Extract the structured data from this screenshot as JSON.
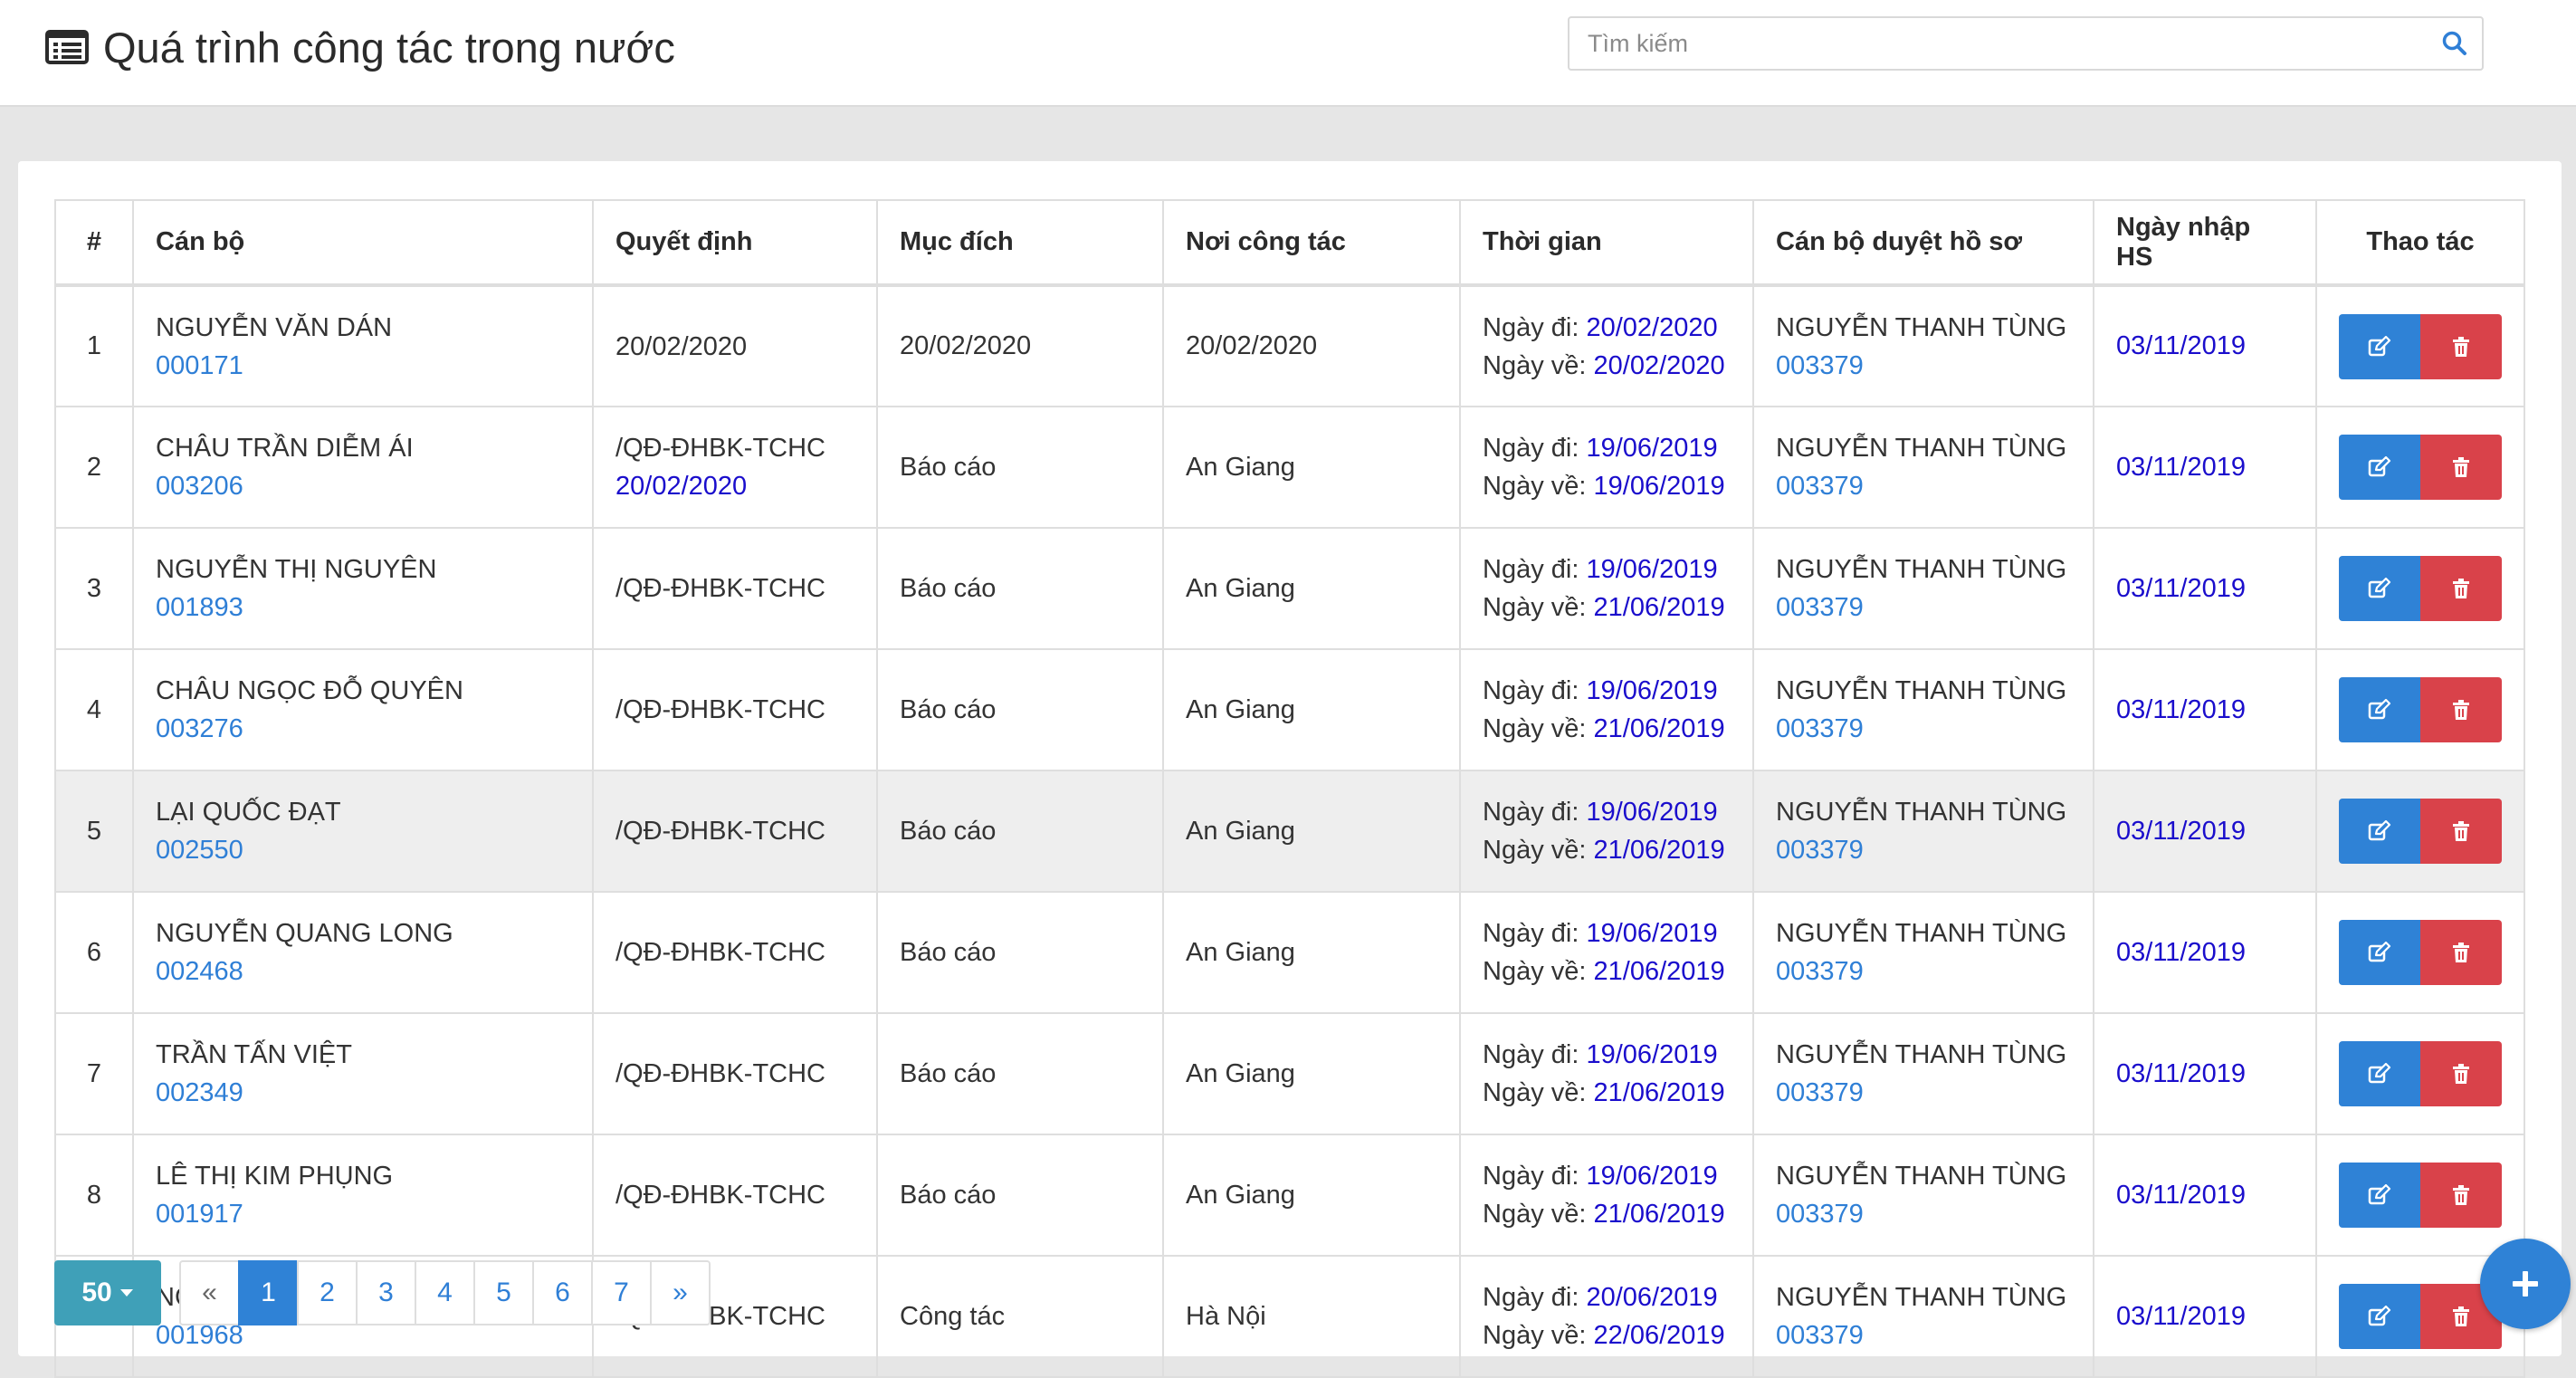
{
  "header": {
    "title": "Quá trình công tác trong nước",
    "search_placeholder": "Tìm kiếm"
  },
  "table": {
    "columns": [
      "#",
      "Cán bộ",
      "Quyết định",
      "Mục đích",
      "Nơi công tác",
      "Thời gian",
      "Cán bộ duyệt hồ sơ",
      "Ngày nhập HS",
      "Thao tác"
    ],
    "go_label": "Ngày đi:",
    "return_label": "Ngày về:",
    "rows": [
      {
        "index": "1",
        "staff_name": "NGUYỄN VĂN DÁN",
        "staff_id": "000171",
        "decision": "20/02/2020",
        "decision_date": "",
        "purpose": "20/02/2020",
        "location": "20/02/2020",
        "date_go": "20/02/2020",
        "date_return": "20/02/2020",
        "approver_name": "NGUYỄN THANH TÙNG",
        "approver_id": "003379",
        "entry_date": "03/11/2019"
      },
      {
        "index": "2",
        "staff_name": "CHÂU TRẦN DIỄM ÁI",
        "staff_id": "003206",
        "decision": "/QĐ-ĐHBK-TCHC",
        "decision_date": "20/02/2020",
        "purpose": "Báo cáo",
        "location": "An Giang",
        "date_go": "19/06/2019",
        "date_return": "19/06/2019",
        "approver_name": "NGUYỄN THANH TÙNG",
        "approver_id": "003379",
        "entry_date": "03/11/2019"
      },
      {
        "index": "3",
        "staff_name": "NGUYỄN THỊ NGUYÊN",
        "staff_id": "001893",
        "decision": "/QĐ-ĐHBK-TCHC",
        "decision_date": "",
        "purpose": "Báo cáo",
        "location": "An Giang",
        "date_go": "19/06/2019",
        "date_return": "21/06/2019",
        "approver_name": "NGUYỄN THANH TÙNG",
        "approver_id": "003379",
        "entry_date": "03/11/2019"
      },
      {
        "index": "4",
        "staff_name": "CHÂU NGỌC ĐỖ QUYÊN",
        "staff_id": "003276",
        "decision": "/QĐ-ĐHBK-TCHC",
        "decision_date": "",
        "purpose": "Báo cáo",
        "location": "An Giang",
        "date_go": "19/06/2019",
        "date_return": "21/06/2019",
        "approver_name": "NGUYỄN THANH TÙNG",
        "approver_id": "003379",
        "entry_date": "03/11/2019"
      },
      {
        "index": "5",
        "staff_name": "LẠI QUỐC ĐẠT",
        "staff_id": "002550",
        "decision": "/QĐ-ĐHBK-TCHC",
        "decision_date": "",
        "purpose": "Báo cáo",
        "location": "An Giang",
        "date_go": "19/06/2019",
        "date_return": "21/06/2019",
        "approver_name": "NGUYỄN THANH TÙNG",
        "approver_id": "003379",
        "entry_date": "03/11/2019"
      },
      {
        "index": "6",
        "staff_name": "NGUYỄN QUANG LONG",
        "staff_id": "002468",
        "decision": "/QĐ-ĐHBK-TCHC",
        "decision_date": "",
        "purpose": "Báo cáo",
        "location": "An Giang",
        "date_go": "19/06/2019",
        "date_return": "21/06/2019",
        "approver_name": "NGUYỄN THANH TÙNG",
        "approver_id": "003379",
        "entry_date": "03/11/2019"
      },
      {
        "index": "7",
        "staff_name": "TRẦN TẤN VIỆT",
        "staff_id": "002349",
        "decision": "/QĐ-ĐHBK-TCHC",
        "decision_date": "",
        "purpose": "Báo cáo",
        "location": "An Giang",
        "date_go": "19/06/2019",
        "date_return": "21/06/2019",
        "approver_name": "NGUYỄN THANH TÙNG",
        "approver_id": "003379",
        "entry_date": "03/11/2019"
      },
      {
        "index": "8",
        "staff_name": "LÊ THỊ KIM PHỤNG",
        "staff_id": "001917",
        "decision": "/QĐ-ĐHBK-TCHC",
        "decision_date": "",
        "purpose": "Báo cáo",
        "location": "An Giang",
        "date_go": "19/06/2019",
        "date_return": "21/06/2019",
        "approver_name": "NGUYỄN THANH TÙNG",
        "approver_id": "003379",
        "entry_date": "03/11/2019"
      },
      {
        "index": "9",
        "staff_name": "NGUYỄN",
        "staff_id": "001968",
        "decision": "/QĐ-ĐHBK-TCHC",
        "decision_date": "",
        "purpose": "Công tác",
        "location": "Hà Nội",
        "date_go": "20/06/2019",
        "date_return": "22/06/2019",
        "approver_name": "NGUYỄN THANH TÙNG",
        "approver_id": "003379",
        "entry_date": "03/11/2019"
      }
    ]
  },
  "pagination": {
    "page_size": "50",
    "prev": "«",
    "next": "»",
    "pages": [
      "1",
      "2",
      "3",
      "4",
      "5",
      "6",
      "7"
    ],
    "active_page": "1"
  },
  "colors": {
    "primary": "#2f82d6",
    "danger": "#d9424a",
    "info": "#3fa0b8",
    "date_blue": "#1a0dcc",
    "id_blue": "#2f7fd6"
  },
  "icons": {
    "title": "list-alt-icon",
    "search": "search-icon",
    "edit": "edit-icon",
    "delete": "trash-icon",
    "add": "plus-icon",
    "dropdown": "caret-down-icon"
  }
}
